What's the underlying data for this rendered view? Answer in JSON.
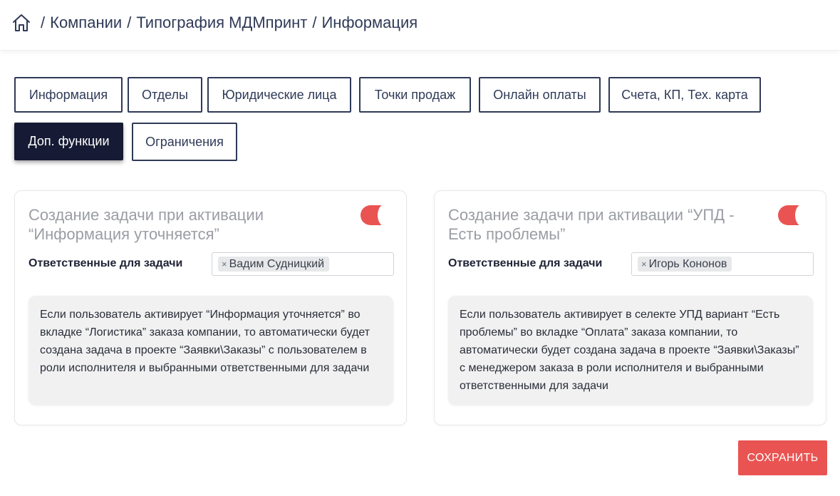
{
  "breadcrumb": {
    "items": [
      "Компании",
      "Типография МДМпринт",
      "Информация"
    ],
    "separator": "/"
  },
  "tabs": [
    {
      "label": "Информация",
      "active": false
    },
    {
      "label": "Отделы",
      "active": false
    },
    {
      "label": "Юридические лица",
      "active": false
    },
    {
      "label": "Точки продаж",
      "active": false
    },
    {
      "label": "Онлайн оплаты",
      "active": false
    },
    {
      "label": "Счета, КП, Тех. карта",
      "active": false
    },
    {
      "label": "Доп. функции",
      "active": true
    },
    {
      "label": "Ограничения",
      "active": false
    }
  ],
  "cards": [
    {
      "title": "Создание задачи при активации “Информация уточняется”",
      "toggle_on": true,
      "field_label": "Ответственные для задачи",
      "chip_remove": "×",
      "chip": "Вадим Судницкий",
      "info": "Если пользователь активирует “Информация уточняется” во вкладке “Логистика” заказа компании, то автоматически будет создана задача в проекте “Заявки\\Заказы” с пользователем в роли исполнителя и выбранными ответственными для задачи"
    },
    {
      "title": "Создание задачи при активации “УПД - Есть проблемы”",
      "toggle_on": true,
      "field_label": "Ответственные для задачи",
      "chip_remove": "×",
      "chip": "Игорь Кононов",
      "info": "Если пользователь активирует в селекте УПД вариант “Есть проблемы” во вкладке “Оплата” заказа компании, то автоматически будет создана задача в проекте “Заявки\\Заказы” с менеджером заказа в роли исполнителя и выбранными ответственными для задачи"
    }
  ],
  "save_label": "СОХРАНИТЬ",
  "colors": {
    "accent": "#e95452",
    "navy": "#2f3a57",
    "active_tab": "#161a34"
  },
  "icons": {
    "home": "home-icon",
    "chip_remove": "close-icon"
  }
}
